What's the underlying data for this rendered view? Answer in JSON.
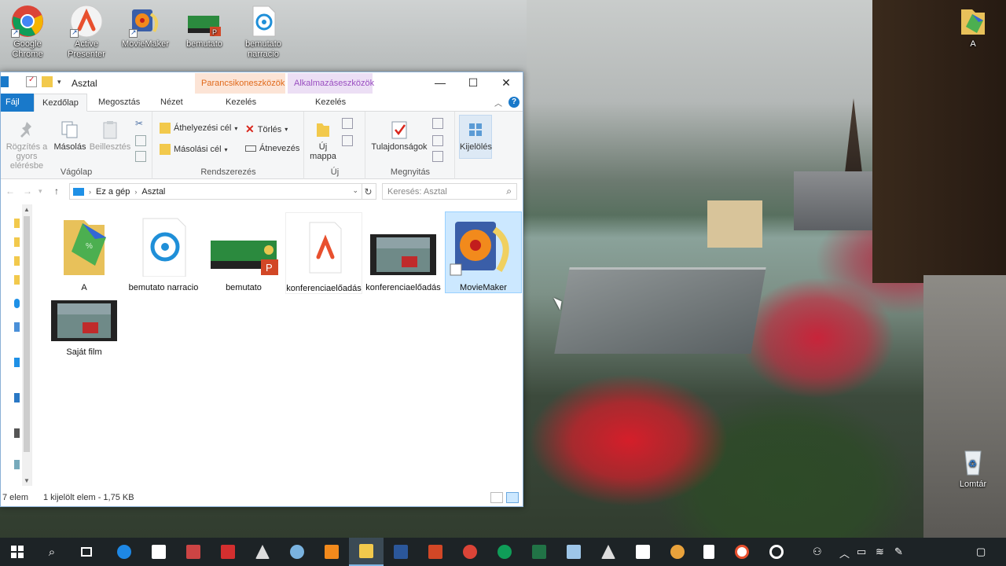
{
  "desktop": {
    "icons": [
      {
        "label": "Google Chrome",
        "icon": "chrome-icon"
      },
      {
        "label": "Active Presenter",
        "icon": "activepresenter-icon"
      },
      {
        "label": "MovieMaker",
        "icon": "moviemaker-icon"
      },
      {
        "label": "bemutato",
        "icon": "powerpoint-file-icon"
      },
      {
        "label": "bemutato narracio",
        "icon": "narration-file-icon"
      },
      {
        "label": "A",
        "icon": "folder-icon"
      },
      {
        "label": "Lomtár",
        "icon": "recycle-bin-icon"
      }
    ]
  },
  "window": {
    "title": "Asztal",
    "context_tabs": [
      "Parancsikoneszközök",
      "Alkalmazáseszközök"
    ],
    "controls": {
      "minimize": "—",
      "maximize": "☐",
      "close": "✕"
    },
    "tabs": [
      "Fájl",
      "Kezdőlap",
      "Megosztás",
      "Nézet",
      "Kezelés",
      "Kezelés"
    ],
    "ribbon": {
      "clipboard": {
        "label": "Vágólap",
        "pin": "Rögzítés a gyors elérésbe",
        "copy": "Másolás",
        "paste": "Beillesztés"
      },
      "organize": {
        "label": "Rendszerezés",
        "move_to": "Áthelyezési cél",
        "copy_to": "Másolási cél",
        "delete": "Törlés",
        "rename": "Átnevezés"
      },
      "new": {
        "label": "Új",
        "new_folder": "Új mappa"
      },
      "open": {
        "label": "Megnyitás",
        "properties": "Tulajdonságok"
      },
      "select": {
        "label": "Kijelölés"
      }
    },
    "address": {
      "path": [
        "Ez a gép",
        "Asztal"
      ],
      "search_placeholder": "Keresés: Asztal"
    },
    "files": [
      {
        "name": "A",
        "type": "folder"
      },
      {
        "name": "bemutato narracio",
        "type": "narration"
      },
      {
        "name": "bemutato",
        "type": "pptx"
      },
      {
        "name": "konferenciaelőadás",
        "type": "ap"
      },
      {
        "name": "konferenciaelőadás",
        "type": "video"
      },
      {
        "name": "MovieMaker",
        "type": "shortcut",
        "selected": true
      },
      {
        "name": "Saját film",
        "type": "video"
      }
    ],
    "status": {
      "count": "7 elem",
      "selection": "1 kijelölt elem - 1,75 KB"
    }
  },
  "colors": {
    "accent": "#1979ca",
    "selection": "#cce8ff",
    "taskbar": "#1d2326"
  }
}
